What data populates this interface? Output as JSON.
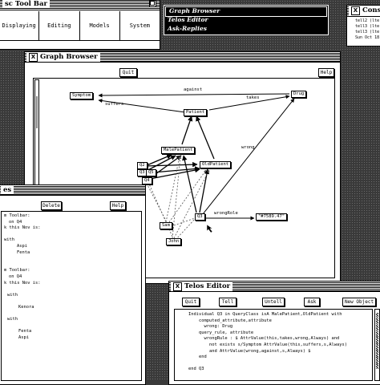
{
  "toolbar": {
    "title": "sc Tool Bar",
    "menus": [
      "Displaying",
      "Editing",
      "Models",
      "System"
    ]
  },
  "app_menu": {
    "items": [
      "Graph Browser",
      "Telos Editor",
      "Ask-Replies"
    ]
  },
  "console": {
    "title": "Conso",
    "lines": [
      "tell2 (lte",
      "tell3 (lte",
      "tell3 (lte",
      "Sun Oct 18"
    ]
  },
  "graph_browser": {
    "title": "Graph Browser",
    "quit_label": "Quit",
    "help_label": "Help",
    "nodes": {
      "symptom": "Symptom",
      "drug": "Drug",
      "patient": "Patient",
      "male_patient": "MalePatient",
      "old_patient": "OldPatient",
      "q2": "Q2",
      "q3": "Q3",
      "q4": "Q4",
      "q5": "Q5",
      "sam": "Sam",
      "john": "John",
      "q3b": "Q3",
      "value": "\"#7589.47\""
    },
    "edges": {
      "against": "against",
      "suffers": "suffers",
      "takes": "takes",
      "wrong": "wrong",
      "wrong_role": "wrongRole"
    }
  },
  "ask_replies": {
    "title": "es",
    "delete_label": "Delete",
    "help_label": "Help",
    "lines": [
      "m Toolbar:",
      "on Q4",
      "k this Nov is:",
      "",
      "with",
      "Aspi",
      "Fenta",
      "",
      "",
      "m Toolbar:",
      "on Q4",
      "k this Nov is:",
      "",
      "with",
      "",
      "Kenora",
      "",
      "with",
      "",
      "Fenta",
      "Aspi"
    ]
  },
  "telos_editor": {
    "title": "Telos Editor",
    "buttons": [
      "Quit",
      "Tell",
      "Untell",
      "Ask",
      "New Object"
    ],
    "lines": [
      "Individual Q3 in QueryClass isA MalePatient,OldPatient with",
      "    computed_attribute,attribute",
      "      wrong: Drug",
      "    query_rule, attribute",
      "      wrongRule : $ AttrValue(this,takes,wrong,Always) and",
      "        not exists s/Symptom AttrValue(this,suffers,s,Always)",
      "        and AttrValue(wrong,against,s,Always) $",
      "    end",
      "",
      "end Q3"
    ]
  },
  "colors": {
    "desktop": "#3a3a3a",
    "window_bg": "#ffffff",
    "menu_bg": "#000000"
  }
}
